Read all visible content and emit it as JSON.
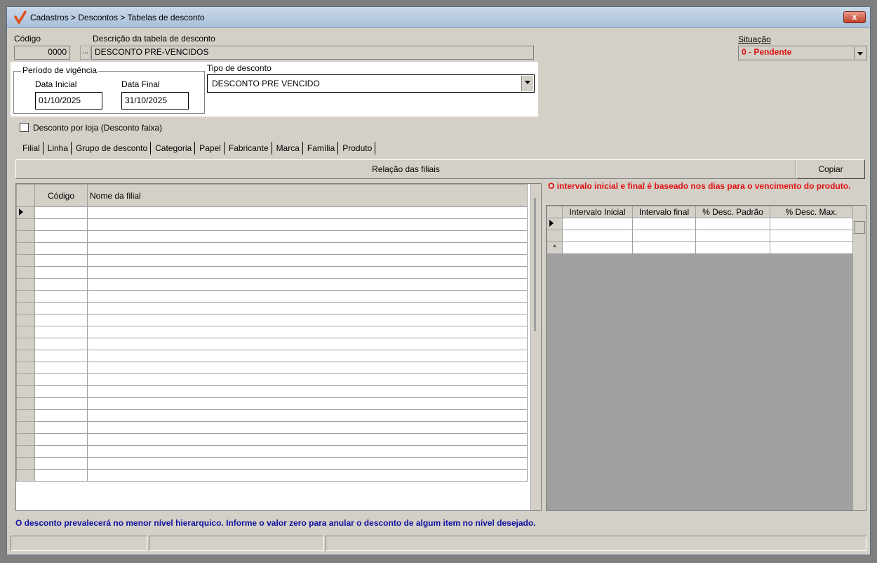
{
  "window": {
    "title": "Cadastros > Descontos > Tabelas de desconto",
    "close_label": "x"
  },
  "form": {
    "codigo_label": "Código",
    "codigo_value": "0000",
    "codigo_lookup": "...",
    "descricao_label": "Descrição da tabela de desconto",
    "descricao_value": "DESCONTO PRE-VENCIDOS",
    "situacao_label": "Situação",
    "situacao_value": "0 - Pendente",
    "periodo_label": "Período de vigência",
    "data_inicial_label": "Data Inicial",
    "data_inicial_value": "01/10/2025",
    "data_final_label": "Data Final",
    "data_final_value": "31/10/2025",
    "tipo_label": "Tipo de desconto",
    "tipo_value": "DESCONTO PRE VENCIDO",
    "desconto_loja_label": "Desconto por loja (Desconto faixa)"
  },
  "tabs": [
    "Filial",
    "Linha",
    "Grupo de desconto",
    "Categoria",
    "Papel",
    "Fabricante",
    "Marca",
    "Família",
    "Produto"
  ],
  "left_panel": {
    "header": "Relação das filiais",
    "columns": [
      "Código",
      "Nome da filial"
    ]
  },
  "right_panel": {
    "copy_button": "Copiar",
    "note": "O intervalo inicial e final é baseado nos dias para o vencimento do produto.",
    "columns": [
      "Intervalo Inicial",
      "Intervalo final",
      "% Desc. Padrão",
      "% Desc. Max."
    ],
    "new_row_marker": "*"
  },
  "footer_note": "O desconto prevalecerá no menor nível hierarquico. Informe o valor zero para anular o desconto de algum item no nível desejado."
}
